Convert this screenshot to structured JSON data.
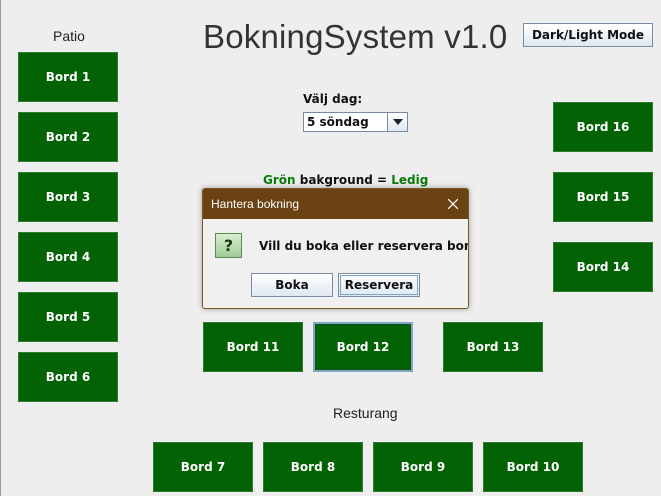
{
  "header": {
    "title": "BokningSystem v1.0",
    "mode_button": "Dark/Light Mode"
  },
  "sections": {
    "patio": "Patio",
    "restaurant": "Resturang"
  },
  "day_picker": {
    "label": "Välj dag:",
    "selected": "5 söndag"
  },
  "legend": {
    "color_word": "Grön",
    "middle": " bakground = ",
    "status_word": "Ledig"
  },
  "tables": {
    "t1": "Bord 1",
    "t2": "Bord 2",
    "t3": "Bord 3",
    "t4": "Bord 4",
    "t5": "Bord 5",
    "t6": "Bord 6",
    "t7": "Bord 7",
    "t8": "Bord 8",
    "t9": "Bord 9",
    "t10": "Bord 10",
    "t11": "Bord 11",
    "t12": "Bord 12",
    "t13": "Bord 13",
    "t14": "Bord 14",
    "t15": "Bord 15",
    "t16": "Bord 16"
  },
  "dialog": {
    "title": "Hantera bokning",
    "message": "Vill du boka eller reservera bordet?",
    "icon": "?",
    "buttons": {
      "book": "Boka",
      "reserve": "Reservera"
    }
  },
  "colors": {
    "table_free": "#036203",
    "dialog_titlebar": "#6b4212",
    "legend_green": "#0a7a0a"
  }
}
